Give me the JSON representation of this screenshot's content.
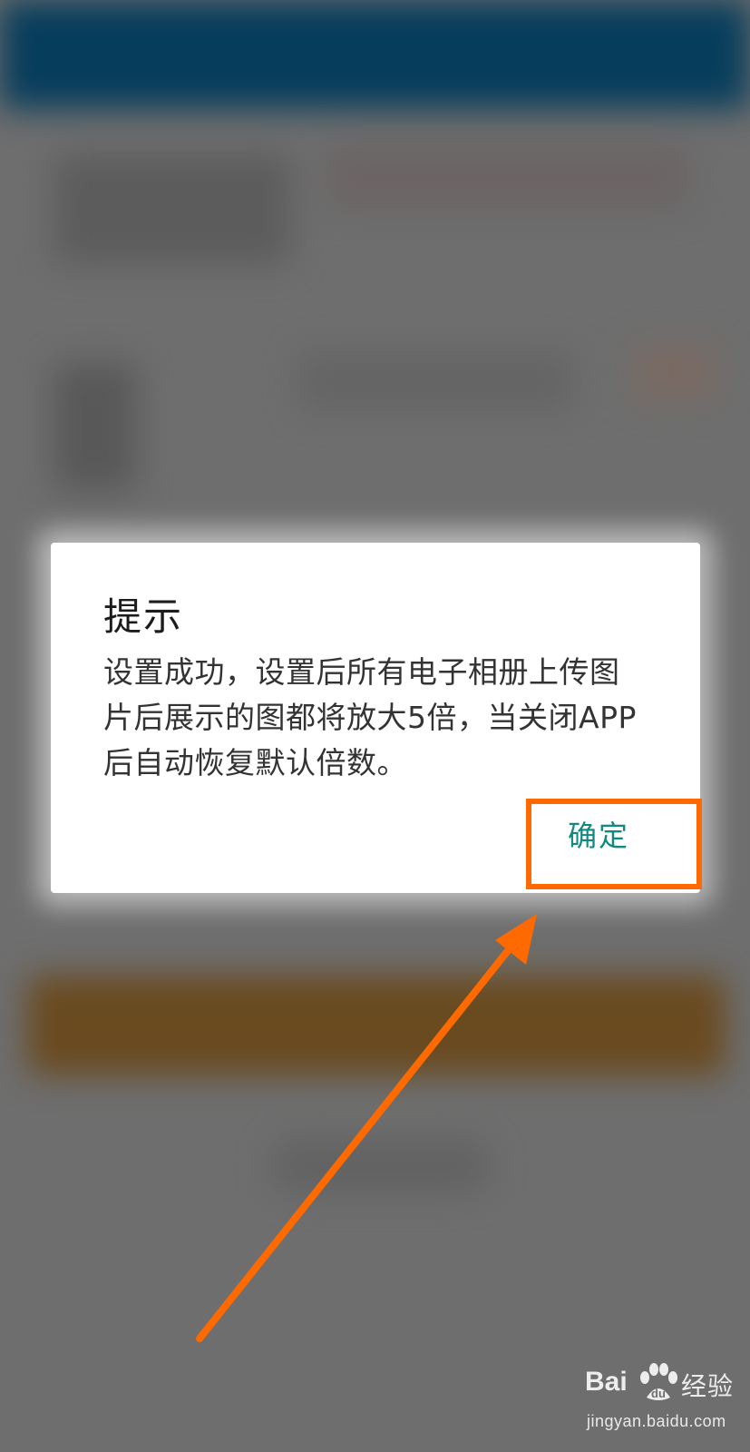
{
  "dialog": {
    "title": "提示",
    "message": "设置成功，设置后所有电子相册上传图片后展示的图都将放大5倍，当关闭APP后自动恢复默认倍数。",
    "confirm_label": "确定"
  },
  "colors": {
    "confirm_text": "#12897f",
    "annotation_orange": "#ff6a00",
    "header_background": "#073d5c",
    "overlay_dim": "#6e6e6e"
  },
  "watermark": {
    "logo_text_left": "Bai",
    "logo_text_right": "经验",
    "url": "jingyan.baidu.com",
    "icon": "baidu-paw-icon"
  },
  "annotation": {
    "icon": "arrow-up-right-icon"
  }
}
